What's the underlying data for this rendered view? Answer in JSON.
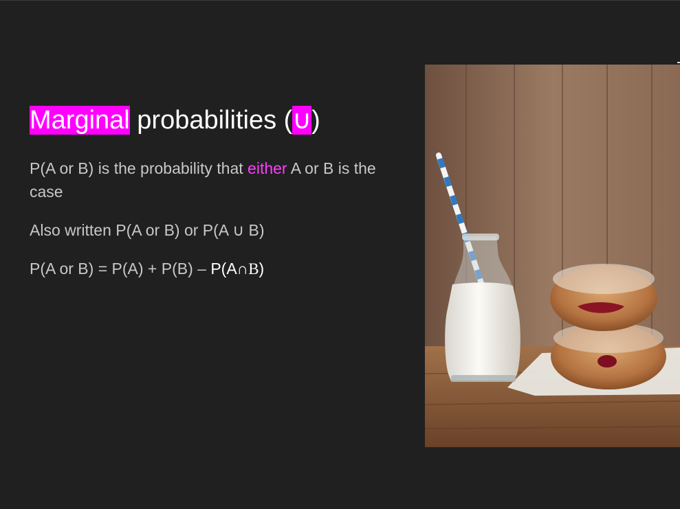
{
  "slide": {
    "title": {
      "highlight_word": "Marginal",
      "rest": " probabilities (",
      "symbol": "∪",
      "close": ")"
    },
    "paragraphs": {
      "p1": {
        "before": "P(A or B) is the probability that ",
        "emphasis": "either",
        "after": " A or B is the case"
      },
      "p2": "Also written P(A or B) or P(A ∪ B)",
      "p3": {
        "lead": "P(A or B) = P(A) + P(B) – ",
        "tail_a": "P(A",
        "tail_cap": "∩",
        "tail_b": "B",
        "tail_close": ")"
      }
    },
    "image": {
      "icon": "photo-milk-bottle-and-jam-doughnuts"
    },
    "colors": {
      "background": "#202020",
      "highlight": "#ff00ff",
      "accent_text": "#ff3cff",
      "body_text": "#c8c8c8"
    }
  }
}
